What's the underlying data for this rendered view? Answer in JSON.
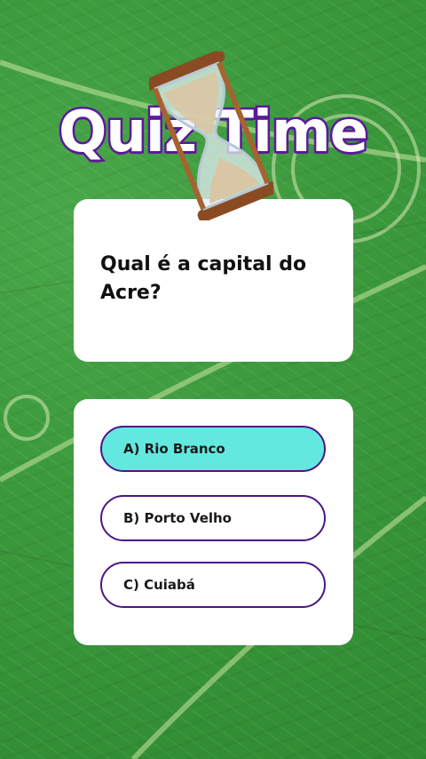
{
  "header": {
    "title": "Quiz Time",
    "hourglass_icon": "hourglass-icon"
  },
  "question": {
    "text": "Qual é a capital do Acre?"
  },
  "options": [
    {
      "label": "A) Rio Branco",
      "selected": true
    },
    {
      "label": "B) Porto Velho",
      "selected": false
    },
    {
      "label": "C) Cuiabá",
      "selected": false
    }
  ],
  "colors": {
    "accent_purple": "#5b1a9a",
    "selected_fill": "#63e8df",
    "background_green": "#3c9a3d",
    "card": "#ffffff"
  }
}
